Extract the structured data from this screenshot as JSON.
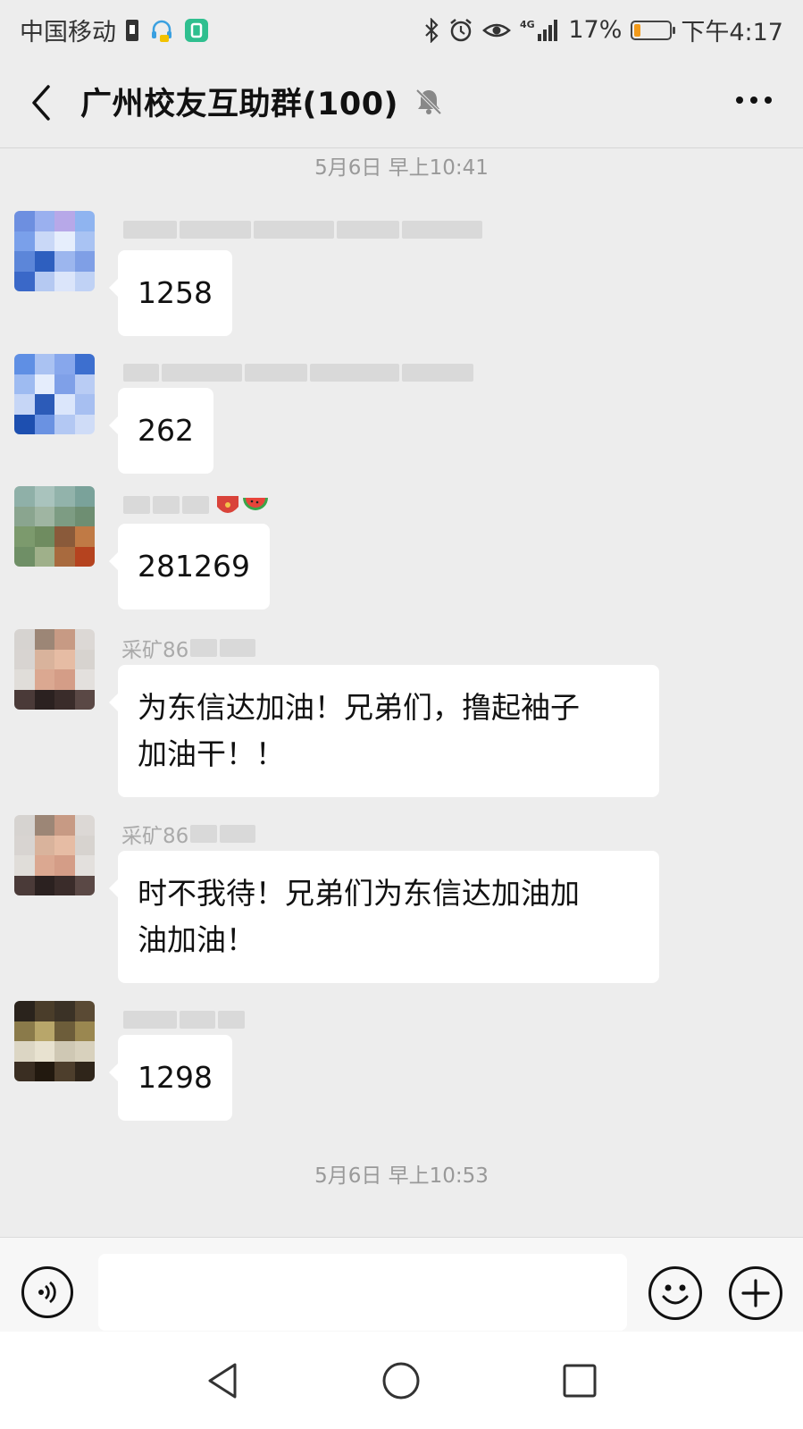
{
  "status_bar": {
    "carrier": "中国移动",
    "network": "4G",
    "battery_percent": "17%",
    "battery_level": 0.17,
    "time": "下午4:17"
  },
  "header": {
    "title": "广州校友互助群(100)",
    "back_icon": "chevron-left-icon",
    "mute_icon": "bell-muted-icon",
    "more_icon": "more-dots-icon"
  },
  "chat": {
    "time_separators": [
      "5月6日 早上10:41",
      "5月6日 早上10:53"
    ],
    "messages": [
      {
        "sender": "",
        "text": "1258"
      },
      {
        "sender": "",
        "text": "262"
      },
      {
        "sender": "",
        "text": "281269"
      },
      {
        "sender": "采矿86",
        "text": "为东信达加油！兄弟们，撸起袖子\n加油干！！"
      },
      {
        "sender": "采矿86",
        "text": "时不我待！兄弟们为东信达加油加\n油加油！"
      },
      {
        "sender": "",
        "text": "1298"
      }
    ]
  },
  "input_bar": {
    "placeholder": "",
    "value": ""
  },
  "colors": {
    "background": "#ededed",
    "bubble": "#ffffff",
    "battery_low": "#f29a1a"
  }
}
